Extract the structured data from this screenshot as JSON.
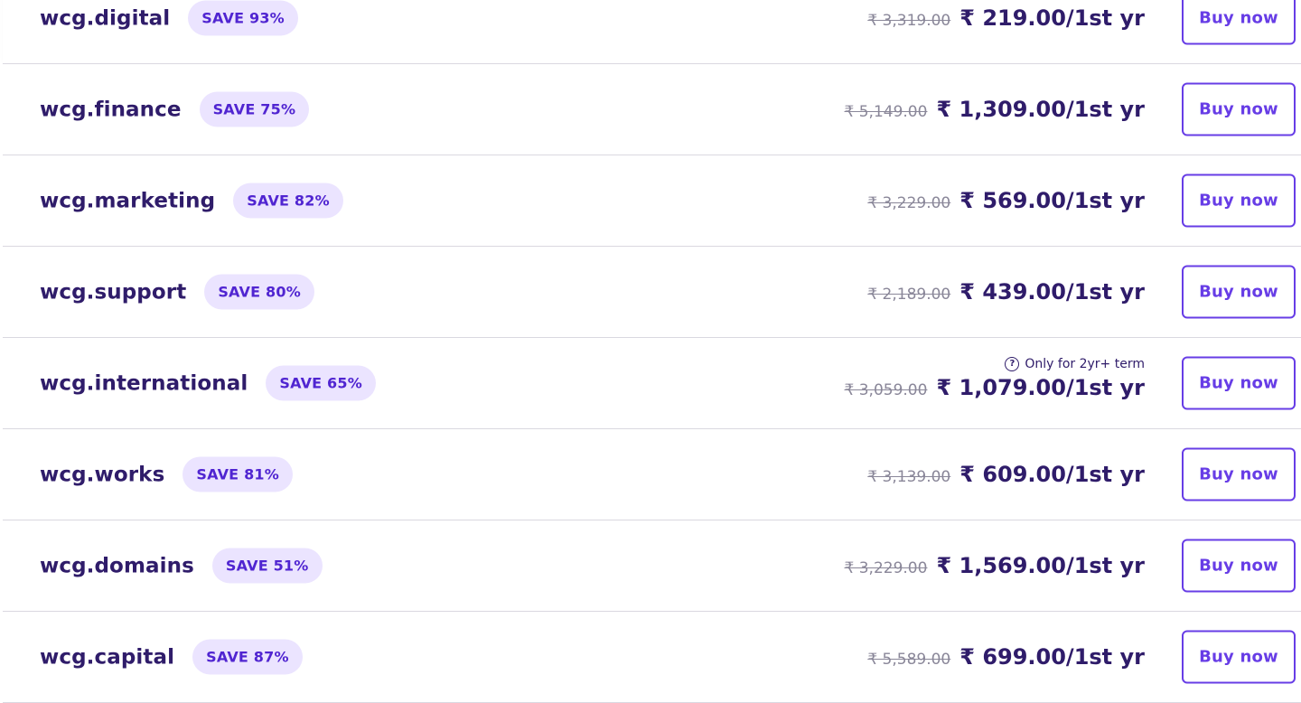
{
  "buy_label": "Buy now",
  "rows": [
    {
      "domain": "wcg.digital",
      "badge": "SAVE 93%",
      "old_price": "₹ 3,319.00",
      "new_price": "₹ 219.00/1st yr",
      "note": ""
    },
    {
      "domain": "wcg.finance",
      "badge": "SAVE 75%",
      "old_price": "₹ 5,149.00",
      "new_price": "₹ 1,309.00/1st yr",
      "note": ""
    },
    {
      "domain": "wcg.marketing",
      "badge": "SAVE 82%",
      "old_price": "₹ 3,229.00",
      "new_price": "₹ 569.00/1st yr",
      "note": ""
    },
    {
      "domain": "wcg.support",
      "badge": "SAVE 80%",
      "old_price": "₹ 2,189.00",
      "new_price": "₹ 439.00/1st yr",
      "note": ""
    },
    {
      "domain": "wcg.international",
      "badge": "SAVE 65%",
      "old_price": "₹ 3,059.00",
      "new_price": "₹ 1,079.00/1st yr",
      "note": "Only for 2yr+ term"
    },
    {
      "domain": "wcg.works",
      "badge": "SAVE 81%",
      "old_price": "₹ 3,139.00",
      "new_price": "₹ 609.00/1st yr",
      "note": ""
    },
    {
      "domain": "wcg.domains",
      "badge": "SAVE 51%",
      "old_price": "₹ 3,229.00",
      "new_price": "₹ 1,569.00/1st yr",
      "note": ""
    },
    {
      "domain": "wcg.capital",
      "badge": "SAVE 87%",
      "old_price": "₹ 5,589.00",
      "new_price": "₹ 699.00/1st yr",
      "note": ""
    }
  ],
  "colors": {
    "accent": "#673de6",
    "text_dark": "#2f1c6a",
    "badge_bg": "#ebe4ff",
    "badge_text": "#5025d1"
  }
}
